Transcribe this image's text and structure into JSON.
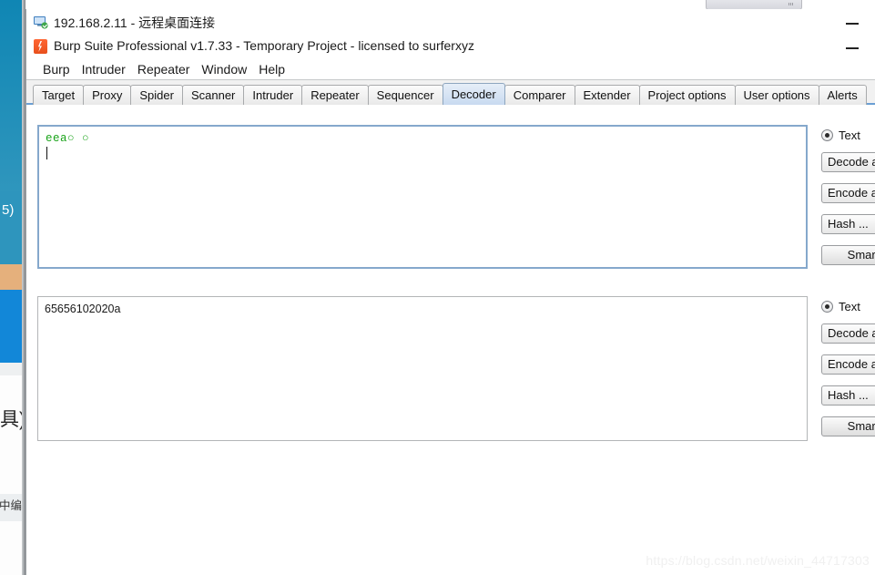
{
  "background_window": {
    "fragment_number": "5)",
    "fragment_cn_1": "具)",
    "fragment_cn_2": "中编码"
  },
  "rdp": {
    "connection_bar_name": "rdp-connection-bar",
    "title": "192.168.2.11 - 远程桌面连接",
    "minimize_label": "—"
  },
  "burp": {
    "title": "Burp Suite Professional v1.7.33 - Temporary Project - licensed to surferxyz",
    "minimize_label": "—",
    "menu": [
      {
        "label": "Burp"
      },
      {
        "label": "Intruder"
      },
      {
        "label": "Repeater"
      },
      {
        "label": "Window"
      },
      {
        "label": "Help"
      }
    ],
    "tabs": [
      {
        "label": "Target",
        "active": false
      },
      {
        "label": "Proxy",
        "active": false
      },
      {
        "label": "Spider",
        "active": false
      },
      {
        "label": "Scanner",
        "active": false
      },
      {
        "label": "Intruder",
        "active": false
      },
      {
        "label": "Repeater",
        "active": false
      },
      {
        "label": "Sequencer",
        "active": false
      },
      {
        "label": "Decoder",
        "active": true
      },
      {
        "label": "Comparer",
        "active": false
      },
      {
        "label": "Extender",
        "active": false
      },
      {
        "label": "Project options",
        "active": false
      },
      {
        "label": "User options",
        "active": false
      },
      {
        "label": "Alerts",
        "active": false
      }
    ]
  },
  "decoder": {
    "input_panel": {
      "name": "decoder-input-panel",
      "text": "eea○ ○",
      "focused": true
    },
    "output_panel": {
      "name": "decoder-output-panel",
      "text": "65656102020a",
      "focused": false
    },
    "controls_top": {
      "radio_text_label": "Text",
      "radio_text_selected": true,
      "radio_hex_label": "",
      "buttons": [
        {
          "label": "Decode a"
        },
        {
          "label": "Encode a"
        },
        {
          "label": "Hash ..."
        },
        {
          "label": "Smart",
          "style": "smart"
        }
      ]
    },
    "controls_bottom": {
      "radio_text_label": "Text",
      "radio_text_selected": true,
      "radio_hex_label": "",
      "buttons": [
        {
          "label": "Decode a"
        },
        {
          "label": "Encode a"
        },
        {
          "label": "Hash ..."
        },
        {
          "label": "Smart",
          "style": "smart"
        }
      ]
    }
  },
  "watermark": {
    "text": "https://blog.csdn.net/weixin_44717303"
  }
}
